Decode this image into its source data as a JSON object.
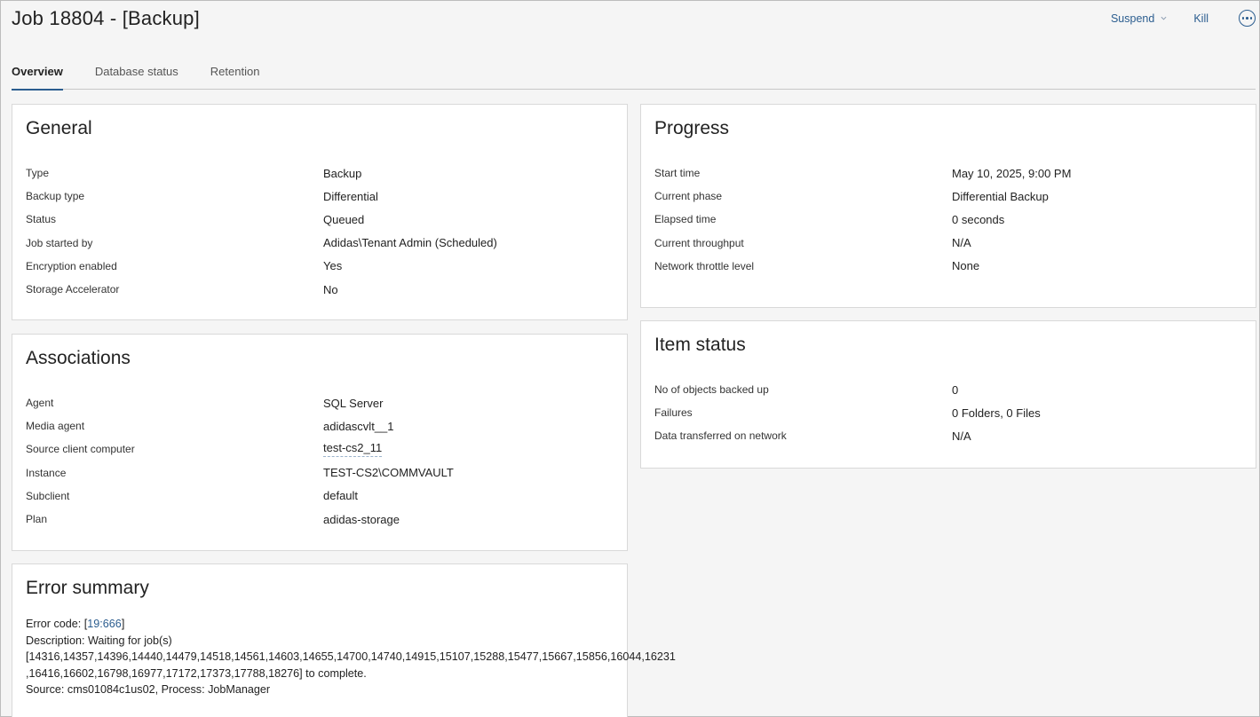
{
  "header": {
    "title": "Job 18804 - [Backup]",
    "suspend_label": "Suspend",
    "kill_label": "Kill"
  },
  "tabs": [
    {
      "label": "Overview",
      "active": true
    },
    {
      "label": "Database status",
      "active": false
    },
    {
      "label": "Retention",
      "active": false
    }
  ],
  "general": {
    "title": "General",
    "rows": [
      {
        "label": "Type",
        "value": "Backup"
      },
      {
        "label": "Backup type",
        "value": "Differential"
      },
      {
        "label": "Status",
        "value": "Queued"
      },
      {
        "label": "Job started by",
        "value": "Adidas\\Tenant Admin (Scheduled)"
      },
      {
        "label": "Encryption enabled",
        "value": "Yes"
      },
      {
        "label": "Storage Accelerator",
        "value": "No"
      }
    ]
  },
  "associations": {
    "title": "Associations",
    "rows": [
      {
        "label": "Agent",
        "value": "SQL Server"
      },
      {
        "label": "Media agent",
        "value": "adidascvlt__1"
      },
      {
        "label": "Source client computer",
        "value": "test-cs2_11"
      },
      {
        "label": "Instance",
        "value": "TEST-CS2\\COMMVAULT"
      },
      {
        "label": "Subclient",
        "value": "default"
      },
      {
        "label": "Plan",
        "value": "adidas-storage"
      }
    ]
  },
  "error_summary": {
    "title": "Error summary",
    "code_prefix": "Error code: [",
    "code": "19:666",
    "code_suffix": "]",
    "description_line1": "Description: Waiting for job(s)",
    "description_line2": "[14316,14357,14396,14440,14479,14518,14561,14603,14655,14700,14740,14915,15107,15288,15477,15667,15856,16044,16231",
    "description_line3": ",16416,16602,16798,16977,17172,17373,17788,18276] to complete.",
    "source": "Source: cms01084c1us02, Process: JobManager"
  },
  "progress": {
    "title": "Progress",
    "rows": [
      {
        "label": "Start time",
        "value": "May 10, 2025, 9:00 PM"
      },
      {
        "label": "Current phase",
        "value": "Differential Backup"
      },
      {
        "label": "Elapsed time",
        "value": "0 seconds"
      },
      {
        "label": "Current throughput",
        "value": "N/A"
      },
      {
        "label": "Network throttle level",
        "value": "None"
      }
    ]
  },
  "item_status": {
    "title": "Item status",
    "rows": [
      {
        "label": "No of objects backed up",
        "value": "0"
      },
      {
        "label": "Failures",
        "value": "0 Folders, 0 Files"
      },
      {
        "label": "Data transferred on network",
        "value": "N/A"
      }
    ]
  }
}
